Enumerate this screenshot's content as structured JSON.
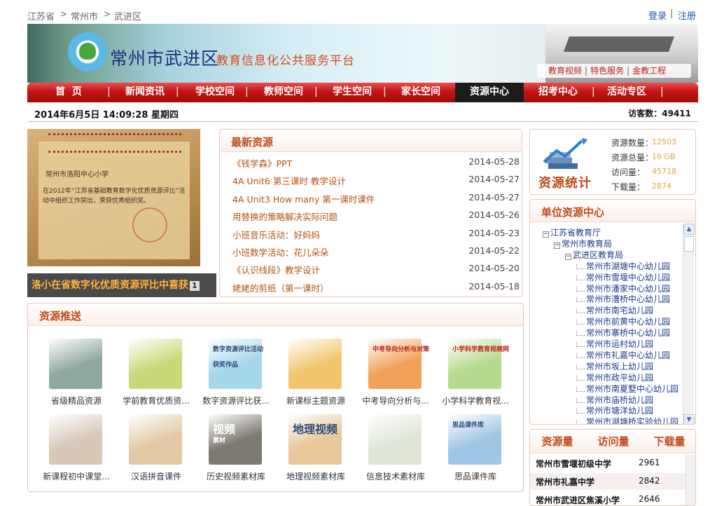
{
  "breadcrumb": [
    "江苏省",
    "常州市",
    "武进区"
  ],
  "breadcrumb_sep": ">",
  "auth": {
    "login": "登录",
    "sep": "|",
    "register": "注册"
  },
  "banner": {
    "title": "常州市武进区",
    "subtitle": "教育信息化公共服务平台",
    "links": [
      "教育视频",
      "特色服务",
      "金教工程"
    ],
    "link_sep": "|"
  },
  "nav": {
    "items": [
      "首  页",
      "新闻资讯",
      "学校空间",
      "教师空间",
      "学生空间",
      "家长空间",
      "资源中心",
      "招考中心",
      "活动专区"
    ],
    "active_index": 6,
    "sep": "|"
  },
  "datebar": {
    "datetime": "2014年6月5日 14:09:28 星期四",
    "visits_label": "访客数：",
    "visits_value": "49411"
  },
  "feature": {
    "image_text_school": "常州市洛阳中心小学",
    "image_text_body": "在2012年“江苏省基础教育数字化优质资源评比”活动中组织工作突出，荣获优秀组织奖。",
    "caption": "洛小在省数字化优质资源评比中喜获",
    "page": "1"
  },
  "latest": {
    "title": "最新资源",
    "items": [
      {
        "title": "《钱学森》PPT",
        "date": "2014-05-28"
      },
      {
        "title": "4A Unit6 第三课时 教学设计",
        "date": "2014-05-27"
      },
      {
        "title": "4A Unit3 How many 第一课时课件",
        "date": "2014-05-27"
      },
      {
        "title": "用替换的策略解决实际问题",
        "date": "2014-05-26"
      },
      {
        "title": "小班音乐活动：好妈妈",
        "date": "2014-05-23"
      },
      {
        "title": "小班数学活动：花儿朵朵",
        "date": "2014-05-22"
      },
      {
        "title": "《认识线段》教学设计",
        "date": "2014-05-20"
      },
      {
        "title": "姥姥的剪纸（第一课时）",
        "date": "2014-05-18"
      }
    ]
  },
  "recommend": {
    "title": "资源推送",
    "items": [
      {
        "label": "省级精品资源",
        "icon": "books-icon",
        "color": "#8fa9a0"
      },
      {
        "label": "学前教育优质资...",
        "icon": "windmill-icon",
        "color": "#c9d97a"
      },
      {
        "label": "数字资源评比获...",
        "icon": "award-banner-icon",
        "color": "#a6d7ea"
      },
      {
        "label": "新课标主题资源",
        "icon": "kids-icon",
        "color": "#f2c56e"
      },
      {
        "label": "中考导向分析与...",
        "icon": "students-icon",
        "color": "#f0a25a"
      },
      {
        "label": "小学科学教育视...",
        "icon": "science-icon",
        "color": "#b6db8e"
      },
      {
        "label": "新课程初中课堂...",
        "icon": "girl-book-icon",
        "color": "#d9c7b7"
      },
      {
        "label": "汉语拼音课件",
        "icon": "child-icon",
        "color": "#e2c9a6"
      },
      {
        "label": "历史视频素材库",
        "icon": "video-icon",
        "color": "#7d7a72"
      },
      {
        "label": "地理视频素材库",
        "icon": "geo-video-icon",
        "color": "#e8c79a"
      },
      {
        "label": "信息技术素材库",
        "icon": "mouse-icon",
        "color": "#dfe6d8"
      },
      {
        "label": "思品课件库",
        "icon": "book-stack-icon",
        "color": "#9fc6e4"
      }
    ],
    "overlay_texts": {
      "award": "数字资源评比活动",
      "award2": "获奖作品",
      "kp": "中考导向分析与对策",
      "sci": "小学科学教育视频网",
      "video": "视频",
      "video_sub": "素材",
      "geo": "地理视频",
      "sp": "思品课件库"
    }
  },
  "stats": {
    "label": "资源统计",
    "rows": [
      {
        "label": "资源数量：",
        "value": "12503"
      },
      {
        "label": "资源总量：",
        "value": "16 GB"
      },
      {
        "label": "访问量：",
        "value": "45718"
      },
      {
        "label": "下载量：",
        "value": "2874"
      }
    ]
  },
  "units": {
    "title": "单位资源中心",
    "tree": [
      {
        "label": "江苏省教育厅",
        "level": 0,
        "expander": "−"
      },
      {
        "label": "常州市教育局",
        "level": 1,
        "expander": "−"
      },
      {
        "label": "武进区教育局",
        "level": 2,
        "expander": "−"
      },
      {
        "label": "常州市湖塘中心幼儿园",
        "level": 3
      },
      {
        "label": "常州市雪堰中心幼儿园",
        "level": 3
      },
      {
        "label": "常州市潘家中心幼儿园",
        "level": 3
      },
      {
        "label": "常州市漕桥中心幼儿园",
        "level": 3
      },
      {
        "label": "常州市南宅幼儿园",
        "level": 3
      },
      {
        "label": "常州市前黄中心幼儿园",
        "level": 3
      },
      {
        "label": "常州市寨桥中心幼儿园",
        "level": 3
      },
      {
        "label": "常州市运村幼儿园",
        "level": 3
      },
      {
        "label": "常州市礼嘉中心幼儿园",
        "level": 3
      },
      {
        "label": "常州市坂上幼儿园",
        "level": 3
      },
      {
        "label": "常州市政平幼儿园",
        "level": 3
      },
      {
        "label": "常州市南夏墅中心幼儿园",
        "level": 3
      },
      {
        "label": "常州市庙桥幼儿园",
        "level": 3
      },
      {
        "label": "常州市塘洋幼儿园",
        "level": 3
      },
      {
        "label": "常州市湖塘桥实验幼儿园",
        "level": 3
      }
    ]
  },
  "ranking": {
    "tabs": [
      "资源量",
      "访问量",
      "下载量"
    ],
    "rows": [
      {
        "name": "常州市雪堰初级中学",
        "count": "2961"
      },
      {
        "name": "常州市礼嘉中学",
        "count": "2842"
      },
      {
        "name": "常州市武进区焦溪小学",
        "count": "2646"
      }
    ]
  },
  "colors": {
    "accent": "#c41414",
    "title": "#c04a1a",
    "link": "#b4520e",
    "stat_value": "#e8a33a"
  }
}
